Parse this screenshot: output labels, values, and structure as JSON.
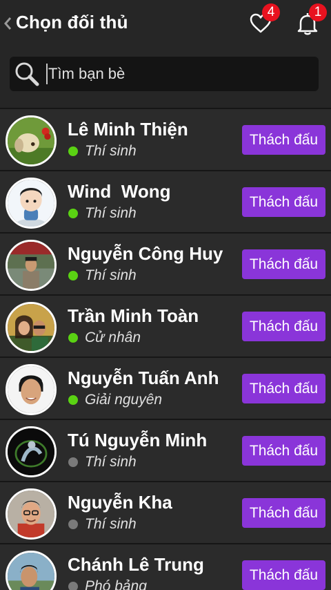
{
  "header": {
    "title": "Chọn đối thủ",
    "back_icon": "chevron-left-icon",
    "heart_icon": "heart-icon",
    "bell_icon": "bell-icon",
    "heart_badge": "4",
    "bell_badge": "1"
  },
  "search": {
    "placeholder": "Tìm bạn bè",
    "icon": "search-icon"
  },
  "colors": {
    "background": "#262626",
    "row": "#2b2b2b",
    "accent_purple": "#8a35d9",
    "badge_red": "#e8121f",
    "online_green": "#5ad213",
    "offline_gray": "#7a7a7a"
  },
  "players": [
    {
      "name": "Lê Minh Thiện",
      "status": "Thí sinh",
      "online": true,
      "action": "Thách đấu"
    },
    {
      "name": "Wind  Wong",
      "status": "Thí sinh",
      "online": true,
      "action": "Thách đấu"
    },
    {
      "name": "Nguyễn Công Huy",
      "status": "Thí sinh",
      "online": true,
      "action": "Thách đấu"
    },
    {
      "name": "Trần Minh Toàn",
      "status": "Cử nhân",
      "online": true,
      "action": "Thách đấu"
    },
    {
      "name": "Nguyễn Tuấn Anh",
      "status": "Giải nguyên",
      "online": true,
      "action": "Thách đấu"
    },
    {
      "name": "Tú Nguyễn Minh",
      "status": "Thí sinh",
      "online": false,
      "action": "Thách đấu"
    },
    {
      "name": "Nguyễn Kha",
      "status": "Thí sinh",
      "online": false,
      "action": "Thách đấu"
    },
    {
      "name": "Chánh Lê Trung",
      "status": "Phó bảng",
      "online": false,
      "action": "Thách đấu"
    }
  ]
}
